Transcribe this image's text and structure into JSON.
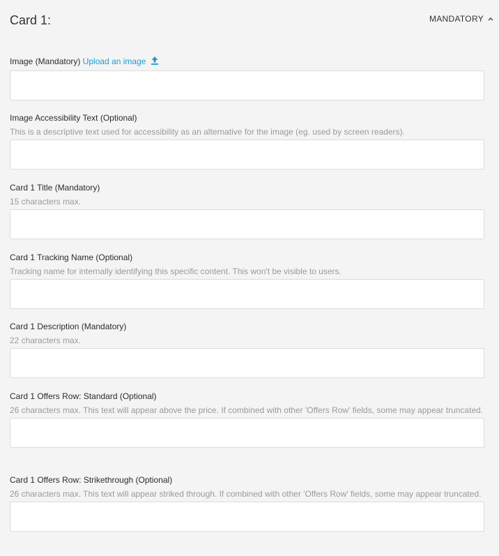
{
  "header": {
    "title": "Card 1:",
    "toggle_label": "MANDATORY",
    "toggle_icon": "chevron-up-icon"
  },
  "fields": [
    {
      "label": "Image (Mandatory)",
      "link": "Upload an image",
      "link_icon": "upload-icon",
      "hint": "",
      "value": ""
    },
    {
      "label": "Image Accessibility Text (Optional)",
      "hint": "This is a descriptive text used for accessibility as an alternative for the image (eg. used by screen readers).",
      "value": ""
    },
    {
      "label": "Card 1 Title (Mandatory)",
      "hint": "15 characters max.",
      "value": ""
    },
    {
      "label": "Card 1 Tracking Name (Optional)",
      "hint": "Tracking name for internally identifying this specific content. This won't be visible to users.",
      "value": ""
    },
    {
      "label": "Card 1 Description (Mandatory)",
      "hint": "22 characters max.",
      "value": ""
    },
    {
      "label": "Card 1 Offers Row: Standard (Optional)",
      "hint": "26 characters max. This text will appear above the price. If combined with other 'Offers Row' fields, some may appear truncated.",
      "value": ""
    },
    {
      "label": "Card 1 Offers Row: Strikethrough (Optional)",
      "hint": "26 characters max. This text will appear striked through. If combined with other 'Offers Row' fields, some may appear truncated.",
      "value": ""
    }
  ],
  "colors": {
    "background": "#f4f4f4",
    "link": "#1a9bd1",
    "hint_text": "#9a9a9a",
    "input_border": "#dcdcdc"
  }
}
